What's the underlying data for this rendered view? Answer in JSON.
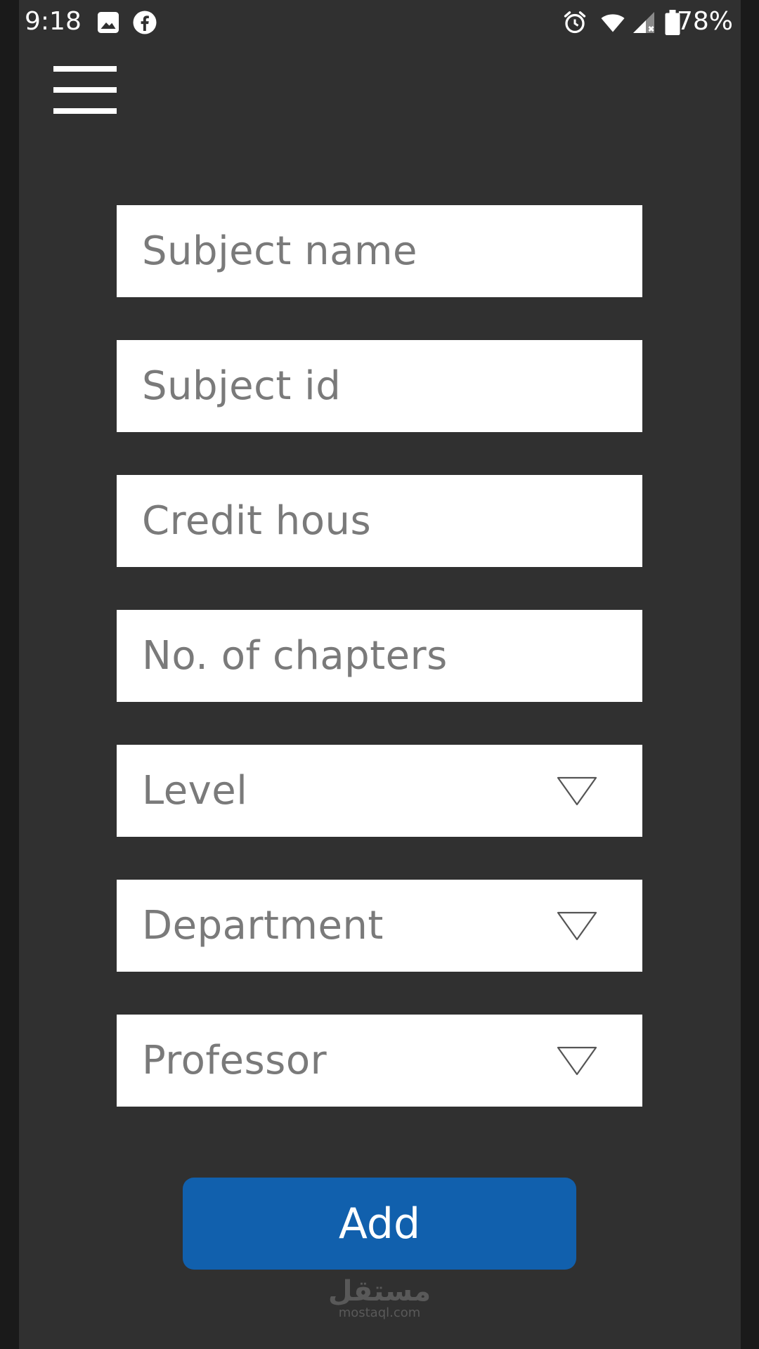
{
  "status_bar": {
    "time": "9:18",
    "battery": "78%",
    "icons": [
      "image-icon",
      "facebook-icon",
      "alarm-icon",
      "wifi-icon",
      "signal-icon",
      "battery-icon"
    ]
  },
  "menu": {
    "icon": "hamburger-menu-icon"
  },
  "form": {
    "subject_name_placeholder": "Subject name",
    "subject_id_placeholder": "Subject id",
    "credit_hours_placeholder": "Credit hous",
    "chapters_placeholder": "No. of chapters",
    "level_label": "Level",
    "department_label": "Department",
    "professor_label": "Professor",
    "add_label": "Add"
  },
  "watermark": {
    "arabic": "مستقل",
    "latin": "mostaql.com"
  },
  "colors": {
    "background": "#303030",
    "field": "#ffffff",
    "placeholder": "#7a7a7a",
    "accent": "#1160ad"
  }
}
